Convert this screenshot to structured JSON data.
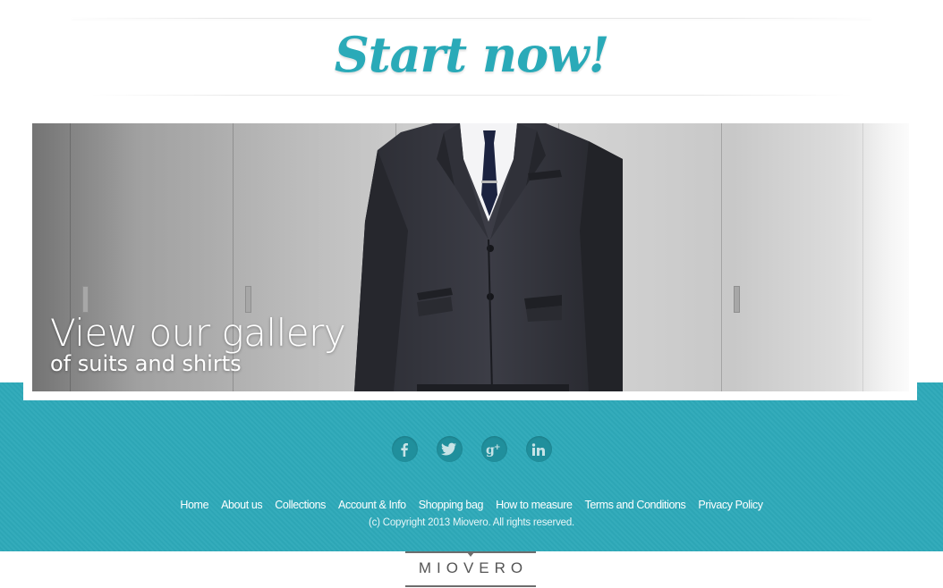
{
  "cta": {
    "title": "Start now!"
  },
  "banner": {
    "headline": "View our gallery",
    "subline": "of suits and shirts"
  },
  "social": [
    {
      "name": "facebook",
      "icon": "facebook-icon"
    },
    {
      "name": "twitter",
      "icon": "twitter-icon"
    },
    {
      "name": "google-plus",
      "icon": "google-plus-icon"
    },
    {
      "name": "linkedin",
      "icon": "linkedin-icon"
    }
  ],
  "footer": {
    "nav": [
      "Home",
      "About us",
      "Collections",
      "Account & Info",
      "Shopping bag",
      "How to measure",
      "Terms and Conditions",
      "Privacy Policy"
    ],
    "copyright": "(c) Copyright 2013 Miovero. All rights reserved."
  },
  "brand": {
    "logo_text": "MIOVERO"
  },
  "colors": {
    "accent": "#2aaab8",
    "footer_bg": "#2ea9b9",
    "social_circle": "#208f9c",
    "logo_gray": "#555555"
  }
}
